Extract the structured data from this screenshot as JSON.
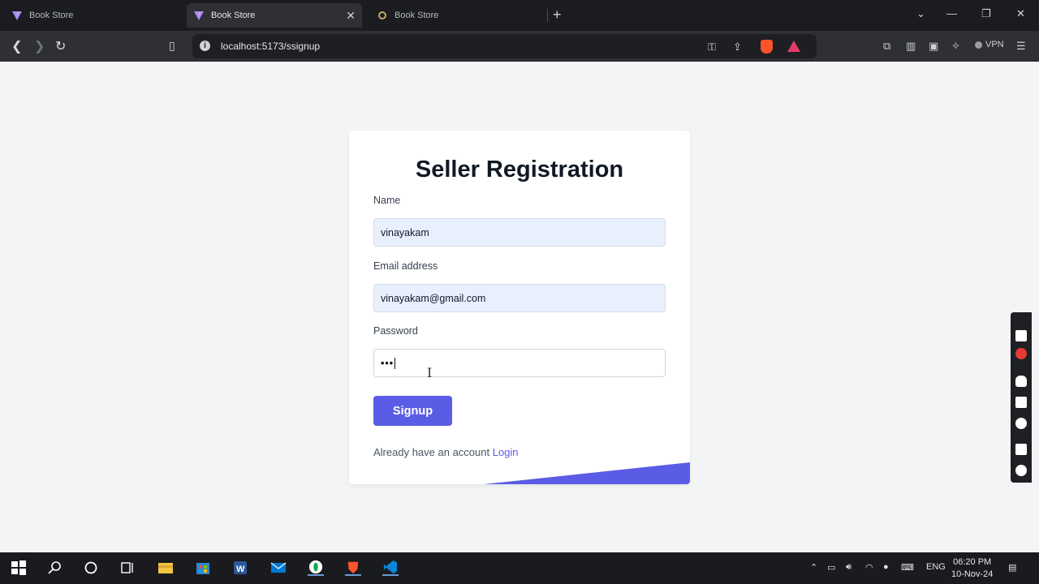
{
  "browser": {
    "tabs": [
      {
        "label": "Book Store",
        "active": false
      },
      {
        "label": "Book Store",
        "active": true
      },
      {
        "label": "Book Store",
        "active": false
      }
    ],
    "address": "localhost:5173/ssignup",
    "vpn_label": "VPN"
  },
  "form": {
    "title": "Seller Registration",
    "name_label": "Name",
    "name_value": "vinayakam",
    "email_label": "Email address",
    "email_value": "vinayakam@gmail.com",
    "password_label": "Password",
    "password_mask": "•••",
    "submit_label": "Signup",
    "footer_text": "Already have an account ",
    "login_link": "Login",
    "accent_color": "#5b5ce6"
  },
  "taskbar": {
    "lang": "ENG",
    "time": "06:20 PM",
    "date": "10-Nov-24"
  }
}
